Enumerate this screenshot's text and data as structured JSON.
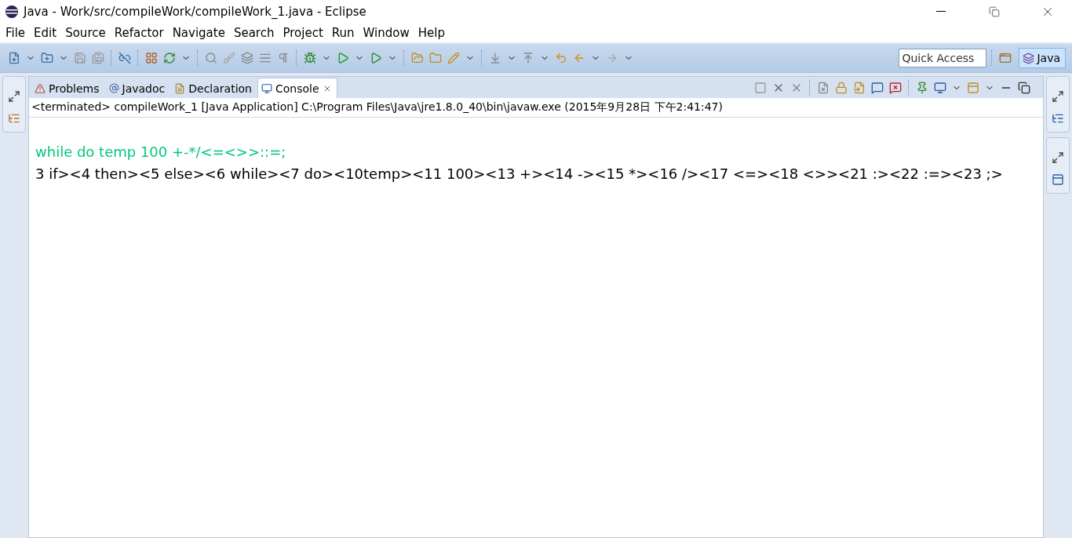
{
  "window": {
    "title": "Java - Work/src/compileWork/compileWork_1.java - Eclipse"
  },
  "menu": [
    "File",
    "Edit",
    "Source",
    "Refactor",
    "Navigate",
    "Search",
    "Project",
    "Run",
    "Window",
    "Help"
  ],
  "quick_access": {
    "placeholder": "Quick Access"
  },
  "perspective": {
    "label": "Java",
    "selected": true
  },
  "tabs": [
    {
      "label": "Problems",
      "selected": false,
      "kind": "problems"
    },
    {
      "label": "Javadoc",
      "selected": false,
      "kind": "javadoc"
    },
    {
      "label": "Declaration",
      "selected": false,
      "kind": "declaration"
    },
    {
      "label": "Console",
      "selected": true,
      "kind": "console",
      "closable": true
    }
  ],
  "console": {
    "header": "<terminated> compileWork_1 [Java Application] C:\\Program Files\\Java\\jre1.8.0_40\\bin\\javaw.exe (2015年9月28日 下午2:41:47)",
    "lines": [
      {
        "text": "while do temp 100 +-*/<=<>>::=;",
        "kind": "input"
      },
      {
        "text": "3 if><4 then><5 else><6 while><7 do><10temp><11 100><13 +><14 -><15 *><16 /><17 <=><18 <>><21 :><22 :=><23 ;>",
        "kind": "output"
      }
    ]
  }
}
